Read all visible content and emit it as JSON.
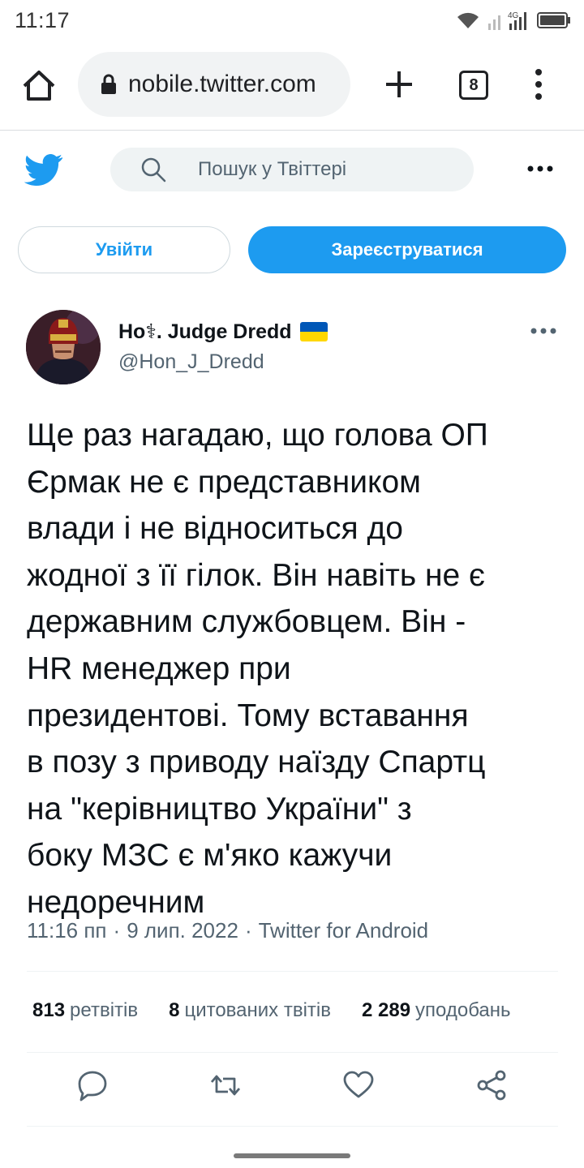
{
  "status_bar": {
    "time": "11:17",
    "network": "4G"
  },
  "browser": {
    "url": "nobile.twitter.com",
    "tab_count": "8"
  },
  "twitter": {
    "search_placeholder": "Пошук у Твіттері",
    "login_label": "Увійти",
    "signup_label": "Зареєструватися"
  },
  "tweet": {
    "display_name": "Ho⚕. Judge Dredd",
    "handle": "@Hon_J_Dredd",
    "text": "Ще раз нагадаю, що голова ОП\nЄрмак не є представником\nвлади і не відноситься до\nжодної з її гілок. Він навіть не є\nдержавним службовцем. Він -\nHR менеджер при\nпрезидентові. Тому вставання\nв позу з приводу наїзду Спартц\nна \"керівництво України\" з\nбоку МЗС є м'яко кажучи\nнедоречним",
    "time": "11:16 пп",
    "separator": "·",
    "date": "9 лип. 2022",
    "source": "Twitter for Android",
    "stats": [
      {
        "count": "813",
        "label": "ретвітів"
      },
      {
        "count": "8",
        "label": "цитованих твітів"
      },
      {
        "count": "2 289",
        "label": "уподобань"
      }
    ]
  },
  "colors": {
    "accent": "#1d9bf0",
    "text_primary": "#0f1419",
    "text_secondary": "#536471",
    "flag_blue": "#0057b7",
    "flag_yellow": "#ffd700"
  },
  "icons": [
    "wifi-icon",
    "signal-icon",
    "battery-icon",
    "home-icon",
    "lock-icon",
    "plus-icon",
    "menu-icon",
    "twitter-bird-icon",
    "search-icon",
    "more-icon",
    "reply-icon",
    "retweet-icon",
    "like-icon",
    "share-icon"
  ]
}
